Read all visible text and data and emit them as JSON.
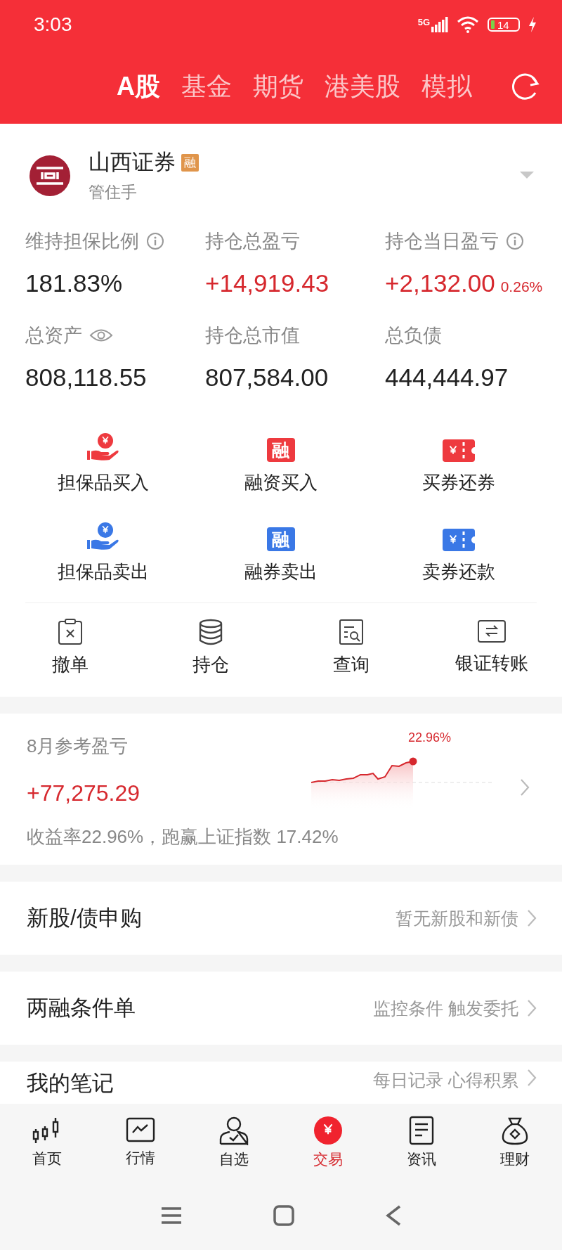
{
  "status_bar": {
    "time": "3:03",
    "network": "5G",
    "battery": "14"
  },
  "tabs": [
    {
      "label": "A股",
      "selected": true
    },
    {
      "label": "基金",
      "selected": false
    },
    {
      "label": "期货",
      "selected": false
    },
    {
      "label": "港美股",
      "selected": false
    },
    {
      "label": "模拟",
      "selected": false
    }
  ],
  "account": {
    "broker": "山西证券",
    "badge": "融",
    "subtitle": "管住手"
  },
  "stats": [
    {
      "kind": "info",
      "label": "维持担保比例",
      "value": "181.83%",
      "color": "#222222"
    },
    {
      "kind": "plain",
      "label": "持仓总盈亏",
      "value": "+14,919.43",
      "color": "#d6282e"
    },
    {
      "kind": "info",
      "label": "持仓当日盈亏",
      "value": "+2,132.00",
      "extra": "0.26%",
      "color": "#d6282e"
    },
    {
      "kind": "eye",
      "label": "总资产",
      "value": "808,118.55",
      "color": "#222222"
    },
    {
      "kind": "plain",
      "label": "持仓总市值",
      "value": "807,584.00",
      "color": "#222222"
    },
    {
      "kind": "plain",
      "label": "总负债",
      "value": "444,444.97",
      "color": "#222222"
    }
  ],
  "trade_actions": [
    {
      "kind": "hand",
      "label": "担保品买入",
      "color": "#ee3a3f"
    },
    {
      "kind": "glyph",
      "icon_text": "融",
      "label": "融资买入",
      "color": "#ee3a3f"
    },
    {
      "kind": "ticket",
      "label": "买券还券",
      "color": "#ee3a3f"
    },
    {
      "kind": "hand",
      "label": "担保品卖出",
      "color": "#3a78e6"
    },
    {
      "kind": "glyph",
      "icon_text": "融",
      "label": "融券卖出",
      "color": "#3a78e6"
    },
    {
      "kind": "ticket",
      "label": "卖券还款",
      "color": "#3a78e6"
    }
  ],
  "tools": [
    {
      "kind": "cancel",
      "label": "撤单"
    },
    {
      "kind": "holdings",
      "label": "持仓"
    },
    {
      "kind": "query",
      "label": "查询"
    },
    {
      "kind": "transfer",
      "label": "银证转账"
    }
  ],
  "monthly": {
    "title": "8月参考盈亏",
    "value": "+77,275.29",
    "summary": "收益率22.96%，跑赢上证指数 17.42%",
    "peak_label": "22.96%"
  },
  "links": [
    {
      "title": "新股/债申购",
      "hint": "暂无新股和新债"
    },
    {
      "title": "两融条件单",
      "hint": "监控条件 触发委托"
    },
    {
      "title": "我的笔记",
      "hint": "每日记录 心得积累"
    }
  ],
  "bottom_nav": [
    {
      "kind": "home",
      "label": "首页",
      "selected": false
    },
    {
      "kind": "market",
      "label": "行情",
      "selected": false
    },
    {
      "kind": "watchlist",
      "label": "自选",
      "selected": false
    },
    {
      "kind": "trade",
      "label": "交易",
      "selected": true
    },
    {
      "kind": "news",
      "label": "资讯",
      "selected": false
    },
    {
      "kind": "wealth",
      "label": "理财",
      "selected": false
    }
  ]
}
